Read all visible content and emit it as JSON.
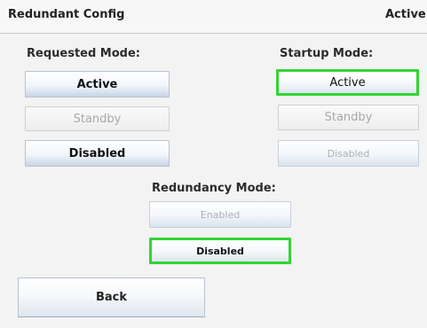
{
  "header": {
    "title": "Redundant Config",
    "status": "Active"
  },
  "requested_mode": {
    "label": "Requested Mode:",
    "options": [
      "Active",
      "Standby",
      "Disabled"
    ]
  },
  "startup_mode": {
    "label": "Startup Mode:",
    "options": [
      "Active",
      "Standby",
      "Disabled"
    ],
    "selected": "Active"
  },
  "redundancy_mode": {
    "label": "Redundancy Mode:",
    "options": [
      "Enabled",
      "Disabled"
    ],
    "selected": "Disabled"
  },
  "back_label": "Back",
  "colors": {
    "selection_outline": "#33d433"
  }
}
